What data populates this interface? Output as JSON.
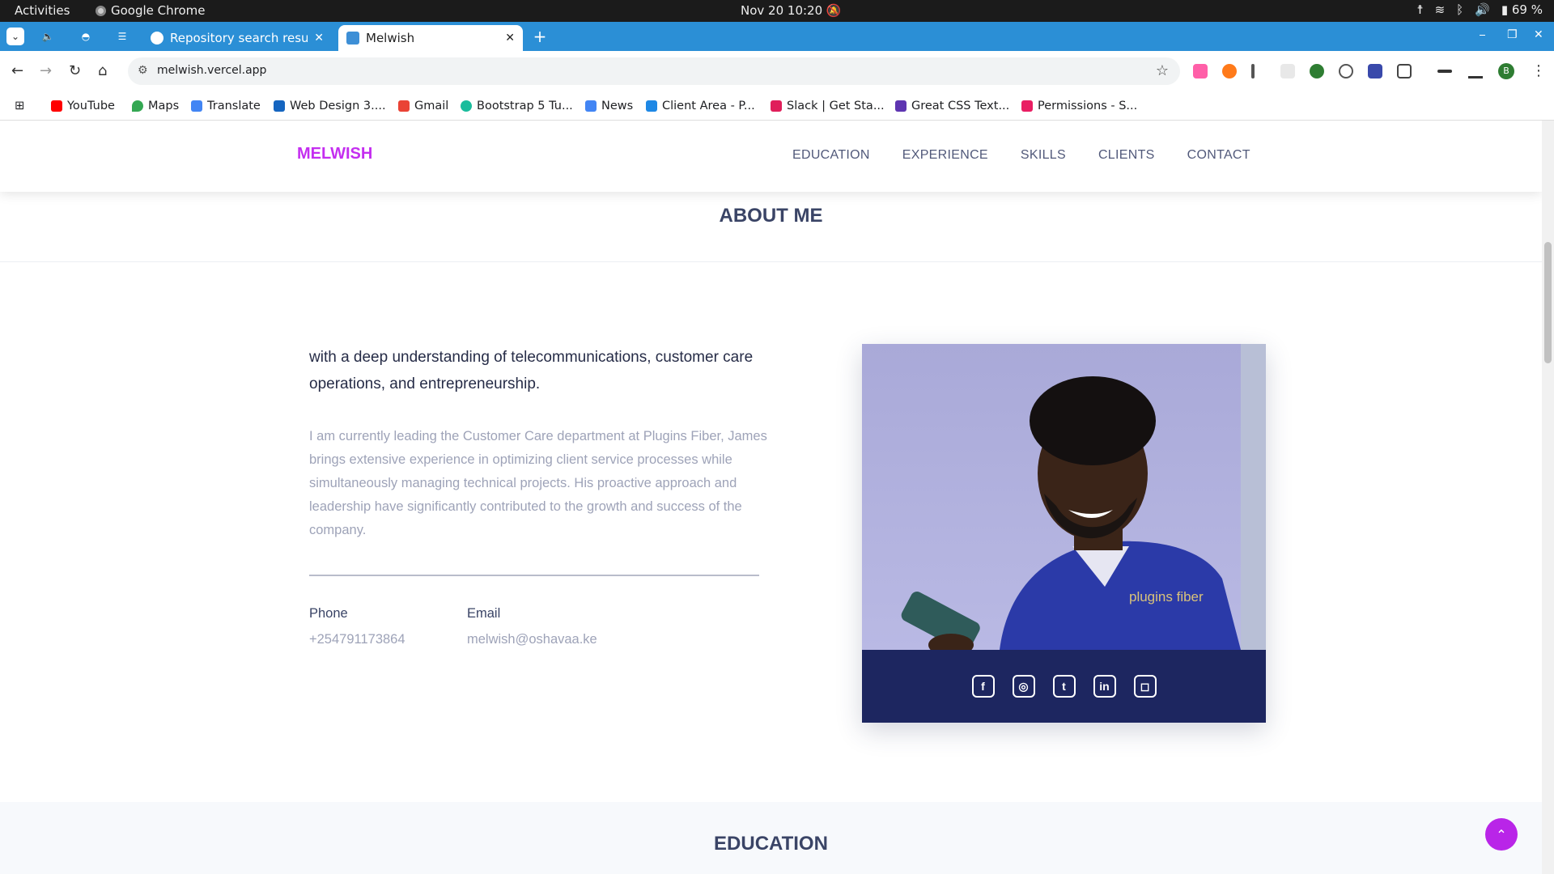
{
  "os": {
    "activities": "Activities",
    "app_name": "Google Chrome",
    "clock": "Nov 20  10:20",
    "battery": "69 %"
  },
  "browser": {
    "tabs": [
      {
        "label": "Repository search result"
      },
      {
        "label": "Melwish"
      }
    ],
    "url": "melwish.vercel.app",
    "profile_initial": "B",
    "bookmarks": [
      {
        "label": "YouTube",
        "color": "#ff0000"
      },
      {
        "label": "Maps",
        "color": "#34a853"
      },
      {
        "label": "Translate",
        "color": "#4285f4"
      },
      {
        "label": "Web Design 3....",
        "color": "#1565c0"
      },
      {
        "label": "Gmail",
        "color": "#ea4335"
      },
      {
        "label": "Bootstrap 5 Tu...",
        "color": "#1abc9c"
      },
      {
        "label": "News",
        "color": "#4285f4"
      },
      {
        "label": "Client Area - P...",
        "color": "#1e88e5"
      },
      {
        "label": "Slack | Get Sta...",
        "color": "#e01e5a"
      },
      {
        "label": "Great CSS Text...",
        "color": "#5e35b1"
      },
      {
        "label": "Permissions - S...",
        "color": "#e91e63"
      }
    ]
  },
  "site": {
    "logo": "MELWISH",
    "brand_color": "#c42ef0",
    "nav": [
      "EDUCATION",
      "EXPERIENCE",
      "SKILLS",
      "CLIENTS",
      "CONTACT"
    ],
    "about": {
      "heading": "ABOUT ME",
      "lead": "with a deep understanding of telecommunications, customer care operations, and entrepreneurship.",
      "description": "I am currently leading the Customer Care department at Plugins Fiber, James brings extensive experience in optimizing client service processes while simultaneously managing technical projects. His proactive approach and leadership have significantly contributed to the growth and success of the company.",
      "phone_label": "Phone",
      "phone_value": "+254791173864",
      "email_label": "Email",
      "email_value": "melwish@oshavaa.ke",
      "photo_shirt_text": "plugins fiber",
      "social": [
        {
          "name": "facebook-icon",
          "glyph": "f"
        },
        {
          "name": "dribbble-icon",
          "glyph": "◎"
        },
        {
          "name": "twitter-icon",
          "glyph": "t"
        },
        {
          "name": "linkedin-icon",
          "glyph": "in"
        },
        {
          "name": "instagram-icon",
          "glyph": "◻"
        }
      ],
      "card_bar_color": "#1d2660"
    },
    "education_heading": "EDUCATION",
    "to_top_glyph": "⌃"
  }
}
